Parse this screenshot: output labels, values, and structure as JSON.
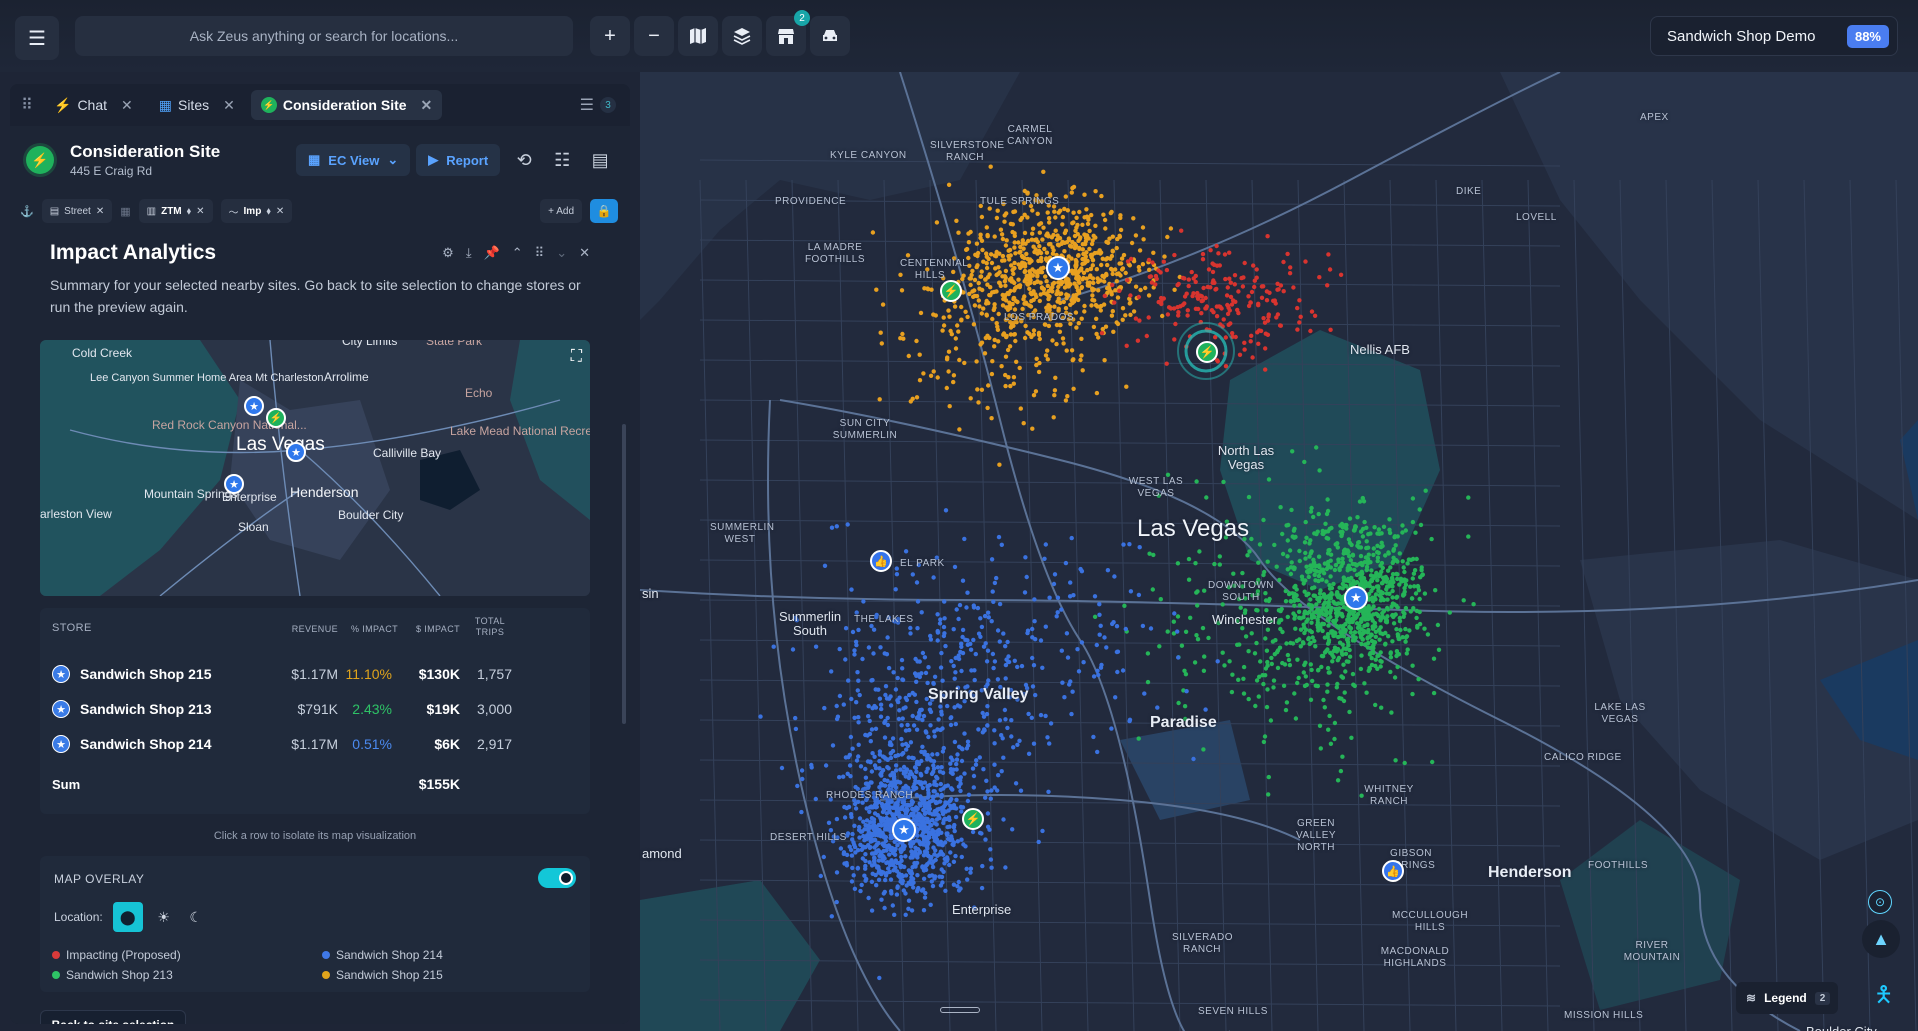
{
  "topbar": {
    "search_placeholder": "Ask Zeus anything or search for locations...",
    "stores_badge": "2",
    "project_name": "Sandwich Shop Demo",
    "project_pct": "88%"
  },
  "tabs": [
    {
      "label": "Chat",
      "icon": "bolt-icon"
    },
    {
      "label": "Sites",
      "icon": "sites-icon"
    },
    {
      "label": "Consideration Site",
      "icon": "bolt-icon",
      "active": true
    }
  ],
  "tabs_count": "3",
  "site": {
    "title": "Consideration Site",
    "address": "445 E Craig Rd",
    "view_label": "EC View",
    "report_label": "Report"
  },
  "chips": {
    "street": "Street",
    "ztm": "ZTM",
    "imp": "Imp",
    "add": "+ Add"
  },
  "impact": {
    "title": "Impact Analytics",
    "description": "Summary for your selected nearby sites. Go back to site selection to change stores or run the preview again."
  },
  "mini_map": {
    "labels": [
      "Cold Creek",
      "Lee Canyon Summer Home Area Mt Charleston",
      "Arrolime",
      "Red Rock Canyon National...",
      "Las Vegas",
      "Calliville Bay",
      "Lake Mead National Recreation Area",
      "Echo",
      "Mountain Springs",
      "Enterprise",
      "Henderson",
      "Boulder City",
      "Sloan",
      "arleston View",
      "State Park",
      "City Limits"
    ]
  },
  "table": {
    "headers": {
      "store": "STORE",
      "revenue": "REVENUE",
      "pct_impact": "% IMPACT",
      "dollar_impact": "$ IMPACT",
      "total_trips_1": "TOTAL",
      "total_trips_2": "TRIPS"
    },
    "rows": [
      {
        "name": "Sandwich Shop 215",
        "revenue": "$1.17M",
        "pct": "11.10%",
        "pct_color": "#e0a41c",
        "impact": "$130K",
        "trips": "1,757"
      },
      {
        "name": "Sandwich Shop 213",
        "revenue": "$791K",
        "pct": "2.43%",
        "pct_color": "#2ec266",
        "impact": "$19K",
        "trips": "3,000"
      },
      {
        "name": "Sandwich Shop 214",
        "revenue": "$1.17M",
        "pct": "0.51%",
        "pct_color": "#4b8af0",
        "impact": "$6K",
        "trips": "2,917"
      }
    ],
    "sum_label": "Sum",
    "sum_value": "$155K",
    "hint": "Click a row to isolate its map visualization"
  },
  "overlay": {
    "title": "MAP OVERLAY",
    "location_label": "Location:",
    "legend": [
      {
        "label": "Impacting (Proposed)",
        "color": "#d83a3a"
      },
      {
        "label": "Sandwich Shop 214",
        "color": "#3f78e6"
      },
      {
        "label": "Sandwich Shop 213",
        "color": "#2ec266"
      },
      {
        "label": "Sandwich Shop 215",
        "color": "#e0a41c"
      }
    ]
  },
  "back_label": "Back to site selection",
  "map": {
    "labels": {
      "carmel_canyon": "CARMEL CANYON",
      "kyle_canyon": "KYLE CANYON",
      "silverstone": "SILVERSTONE RANCH",
      "providence": "PROVIDENCE",
      "tule_springs": "TULE SPRINGS",
      "la_madre": "LA MADRE FOOTHILLS",
      "centennial": "CENTENNIAL HILLS",
      "los_prados": "LOS PRADOS",
      "apex": "APEX",
      "dike": "DIKE",
      "lovell": "LOVELL",
      "nellis": "Nellis AFB",
      "north_lv": "North Las Vegas",
      "sun_city": "SUN CITY SUMMERLIN",
      "west_lv": "WEST LAS VEGAS",
      "las_vegas": "Las Vegas",
      "summerlin_west": "SUMMERLIN WEST",
      "el_park": "EL PARK",
      "downtown_south": "DOWNTOWN SOUTH",
      "winchester": "Winchester",
      "summerlin_south": "Summerlin South",
      "the_lakes": "THE LAKES",
      "sin": "sin",
      "spring_valley": "Spring Valley",
      "paradise": "Paradise",
      "lake_lv": "LAKE LAS VEGAS",
      "calico": "CALICO RIDGE",
      "whitney": "WHITNEY RANCH",
      "rhodes": "RHODES RANCH",
      "desert_hills": "DESERT HILLS",
      "green_valley": "GREEN VALLEY NORTH",
      "gibson": "GIBSON SPRINGS",
      "henderson": "Henderson",
      "foothills": "FOOTHILLS",
      "amond": "amond",
      "enterprise": "Enterprise",
      "silverado": "SILVERADO RANCH",
      "mccullough": "MCCULLOUGH HILLS",
      "macdonald": "MACDONALD HIGHLANDS",
      "river_mountain": "RIVER MOUNTAIN",
      "seven_hills": "SEVEN HILLS",
      "mission_hills": "MISSION HILLS",
      "boulder_city": "Boulder City"
    },
    "legend_label": "Legend",
    "legend_count": "2",
    "colors": {
      "orange": "#e8a020",
      "red": "#d8342f",
      "green": "#25b558",
      "blue": "#3a72e0"
    }
  }
}
